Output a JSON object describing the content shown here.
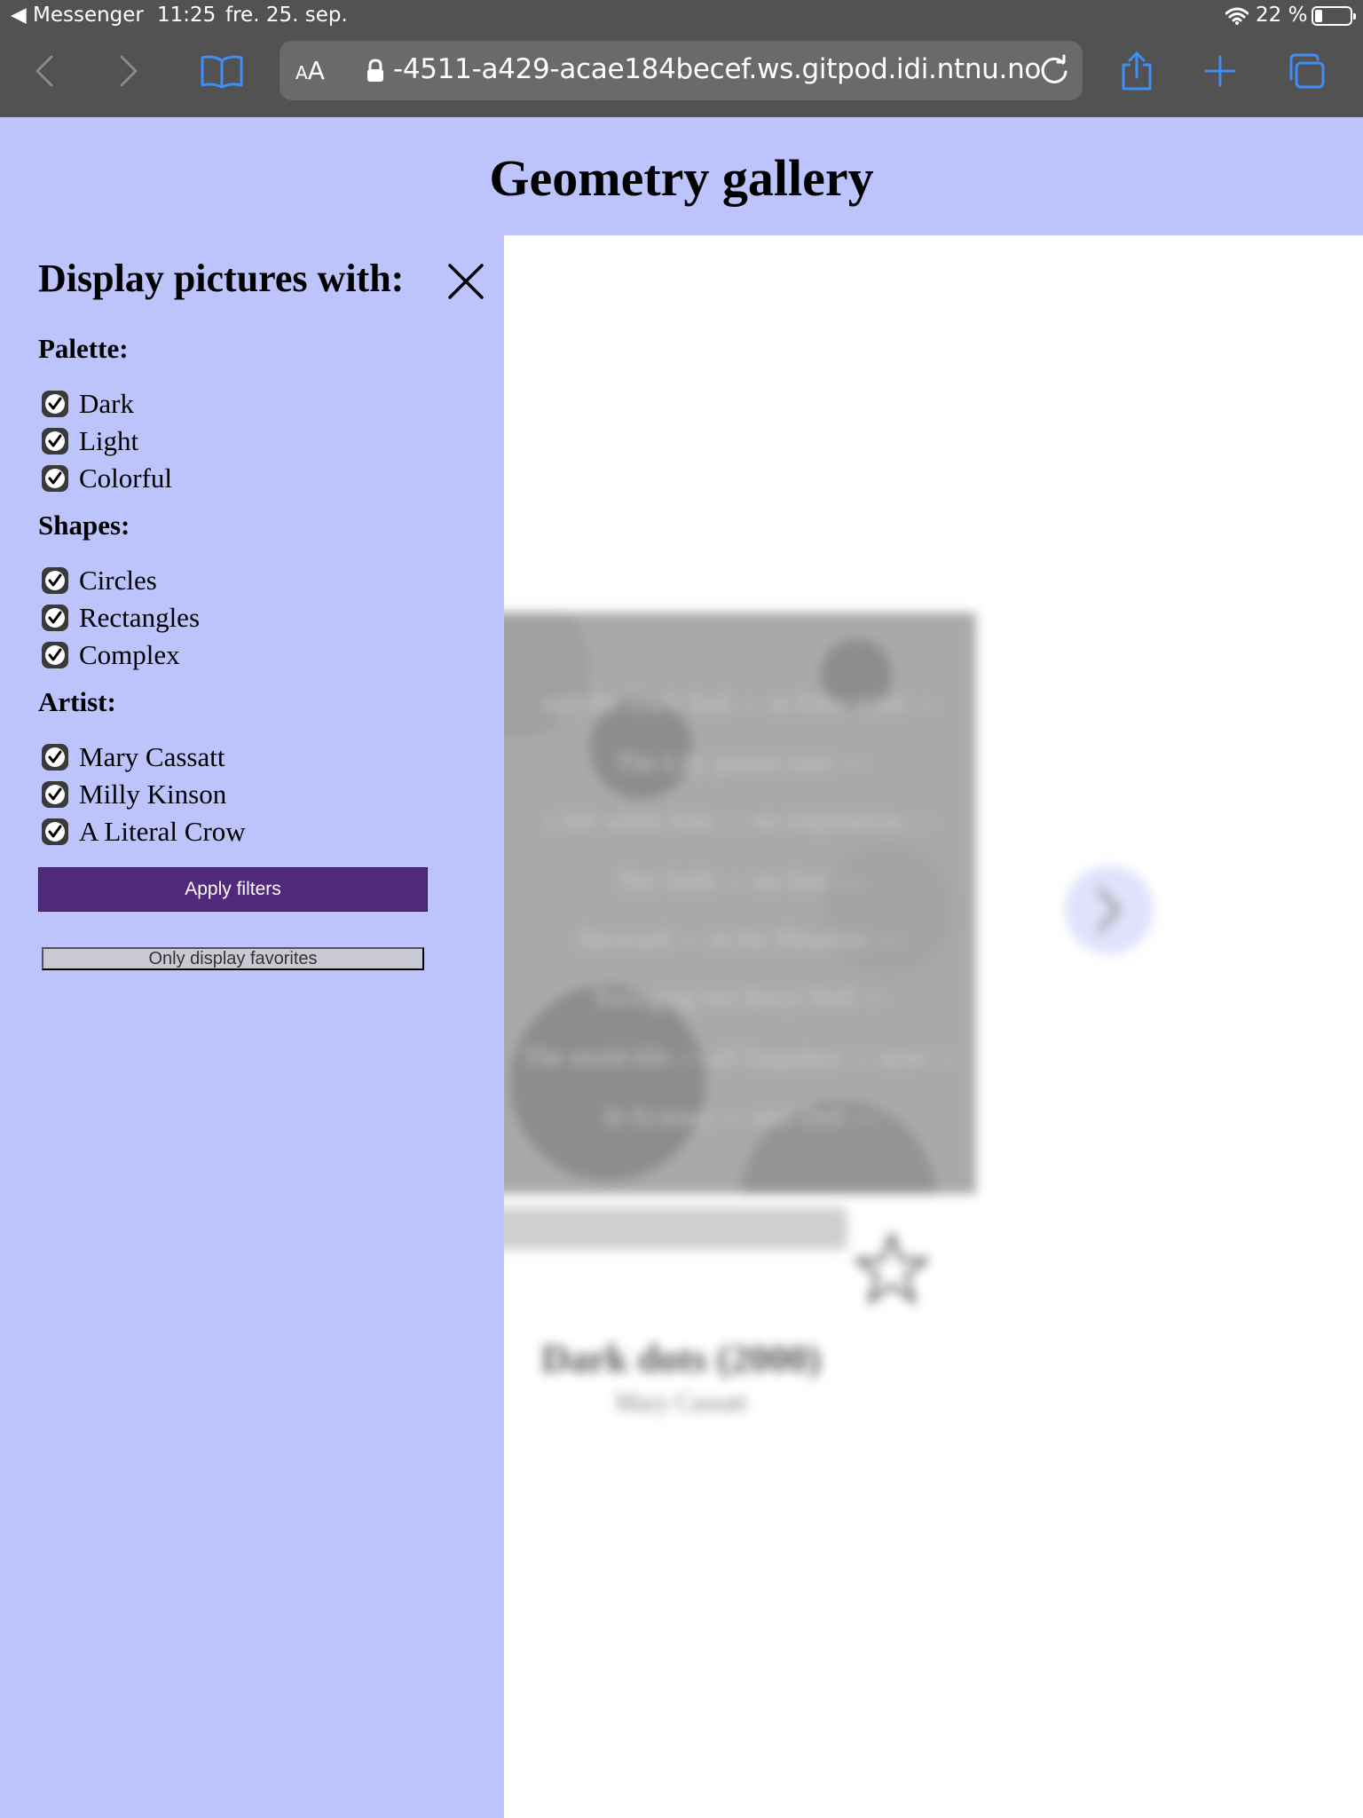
{
  "status_bar": {
    "back_app": "◀ Messenger",
    "time": "11:25",
    "date": "fre. 25. sep.",
    "battery": "22 %"
  },
  "browser": {
    "reader_small": "A",
    "reader_large": "A",
    "url": "-4511-a429-acae184becef.ws.gitpod.idi.ntnu.no",
    "accent_color": "#3f8ef5"
  },
  "header": {
    "title": "Geometry gallery"
  },
  "filters": {
    "title": "Display pictures with:",
    "groups": [
      {
        "heading": "Palette:",
        "options": [
          {
            "label": "Dark",
            "checked": true
          },
          {
            "label": "Light",
            "checked": true
          },
          {
            "label": "Colorful",
            "checked": true
          }
        ]
      },
      {
        "heading": "Shapes:",
        "options": [
          {
            "label": "Circles",
            "checked": true
          },
          {
            "label": "Rectangles",
            "checked": true
          },
          {
            "label": "Complex",
            "checked": true
          }
        ]
      },
      {
        "heading": "Artist:",
        "options": [
          {
            "label": "Mary Cassatt",
            "checked": true
          },
          {
            "label": "Milly Kinson",
            "checked": true
          },
          {
            "label": "A Literal Crow",
            "checked": true
          }
        ]
      }
    ],
    "apply_label": "Apply filters",
    "favorites_label": "Only display favorites",
    "panel_color": "#bcc4fb",
    "apply_color": "#512a7b"
  },
  "artwork": {
    "poem_lines": [
      "ugh the Dark Sod — as Education —",
      "The Lily passes sure —",
      "s her white foot — no trepidation —",
      "Her faith — no fear —",
      "fterward — in the Meadow —",
      "Swinging her Beryl Bell —",
      "The mold-life — all forgotten — now —",
      "In Ecstasy — and Dell —"
    ],
    "title": "Dark dots (2000)",
    "artist": "Mary Cassatt"
  }
}
